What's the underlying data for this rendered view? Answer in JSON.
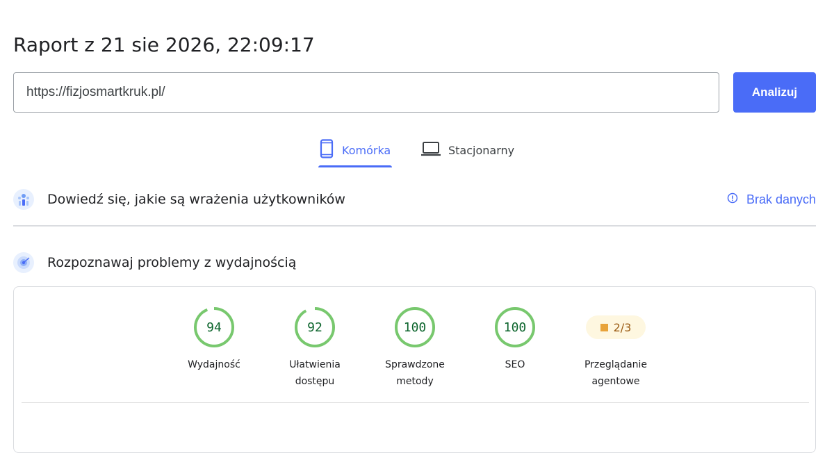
{
  "report": {
    "title": "Raport z 21 sie 2026, 22:09:17"
  },
  "search": {
    "url_value": "https://fizjosmartkruk.pl/",
    "analyze_label": "Analizuj"
  },
  "tabs": [
    {
      "label": "Komórka",
      "icon": "smartphone-icon",
      "active": true
    },
    {
      "label": "Stacjonarny",
      "icon": "laptop-icon",
      "active": false
    }
  ],
  "crux_section": {
    "heading": "Dowiedź się, jakie są wrażenia użytkowników",
    "icon": "users-chart-icon",
    "status_label": "Brak danych",
    "status_icon": "info-icon"
  },
  "perf_section": {
    "heading": "Rozpoznawaj problemy z wydajnością",
    "icon": "lighthouse-icon"
  },
  "scores": [
    {
      "value": "94",
      "label_line1": "Wydajność",
      "label_line2": ""
    },
    {
      "value": "92",
      "label_line1": "Ułatwienia",
      "label_line2": "dostępu"
    },
    {
      "value": "100",
      "label_line1": "Sprawdzone",
      "label_line2": "metody"
    },
    {
      "value": "100",
      "label_line1": "SEO",
      "label_line2": ""
    }
  ],
  "agent_score": {
    "value": "2/3",
    "label_line1": "Przeglądanie",
    "label_line2": "agentowe"
  },
  "colors": {
    "accent": "#4a6cf7",
    "pass_ring": "#78c86e",
    "pass_text": "#0d652d",
    "average": "#e8a33a"
  }
}
